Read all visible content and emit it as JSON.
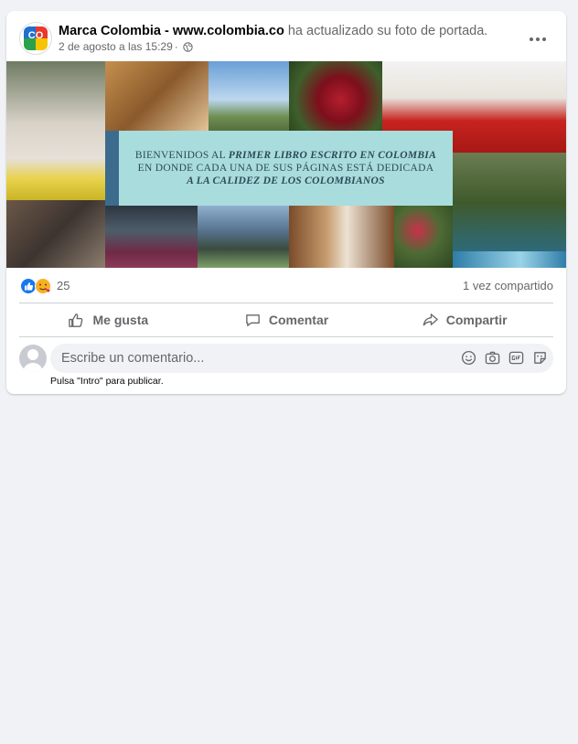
{
  "post": {
    "author": "Marca Colombia - www.colombia.co",
    "action": "ha actualizado su foto de portada.",
    "timestamp": "2 de agosto a las 15:29",
    "meta_separator": "·",
    "avatar_text": "CO",
    "more_icon": "more-options-icon",
    "cover": {
      "banner_line1_prefix": "BIENVENIDOS AL ",
      "banner_line1_emphasis": "PRIMER LIBRO ESCRITO EN COLOMBIA",
      "banner_line2": "EN DONDE CADA UNA DE SUS PÁGINAS ESTÁ DEDICADA",
      "banner_line3": "A LA CALIDEZ DE LOS COLOMBIANOS",
      "banner_color": "#a9dcdc"
    },
    "stats": {
      "reactions_count": "25",
      "shares": "1 vez compartido"
    },
    "actions": {
      "like": "Me gusta",
      "comment": "Comentar",
      "share": "Compartir"
    },
    "comment_box": {
      "placeholder": "Escribe un comentario...",
      "hint": "Pulsa \"Intro\" para publicar.",
      "tools": [
        "emoji-icon",
        "camera-icon",
        "gif-icon",
        "sticker-icon"
      ]
    }
  },
  "colors": {
    "page_bg": "#f0f2f5",
    "card_bg": "#ffffff",
    "secondary_text": "#65676b",
    "like_blue": "#1877f2"
  }
}
